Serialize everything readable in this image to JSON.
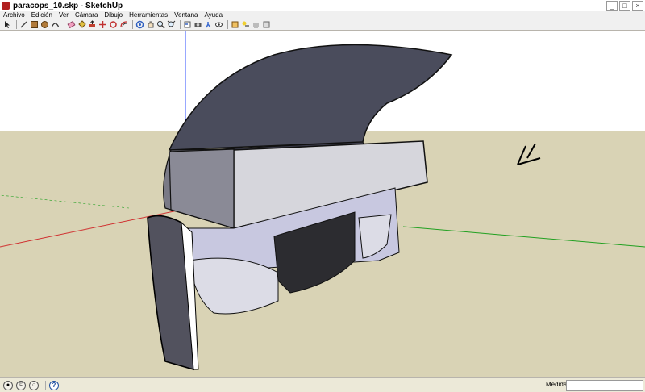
{
  "window": {
    "title": "paracops_10.skp - SketchUp",
    "minimize": "_",
    "maximize": "□",
    "close": "×"
  },
  "menu": {
    "items": [
      "Archivo",
      "Edición",
      "Ver",
      "Cámara",
      "Dibujo",
      "Herramientas",
      "Ventana",
      "Ayuda"
    ]
  },
  "toolbar": {
    "tools": [
      "select-icon",
      "line-icon",
      "rectangle-icon",
      "circle-icon",
      "arc-icon",
      "eraser-icon",
      "paint-bucket-icon",
      "push-pull-icon",
      "move-icon",
      "rotate-icon",
      "offset-icon",
      "orbit-icon",
      "pan-icon",
      "zoom-icon",
      "zoom-extents-icon",
      "component-icon",
      "camera-icon",
      "walk-icon",
      "look-around-icon",
      "section-icon",
      "shadow-icon",
      "fog-icon",
      "style-icon"
    ]
  },
  "status": {
    "measurements_label": "Medidas",
    "measurements_value": "",
    "help": "?"
  },
  "colors": {
    "sky": "#ffffff",
    "ground": "#d9d3b5",
    "red_axis": "#d03030",
    "green_axis": "#20a020",
    "blue_axis": "#3050ff",
    "model_light": "#d6d6dc",
    "model_dark": "#3a3a48"
  }
}
